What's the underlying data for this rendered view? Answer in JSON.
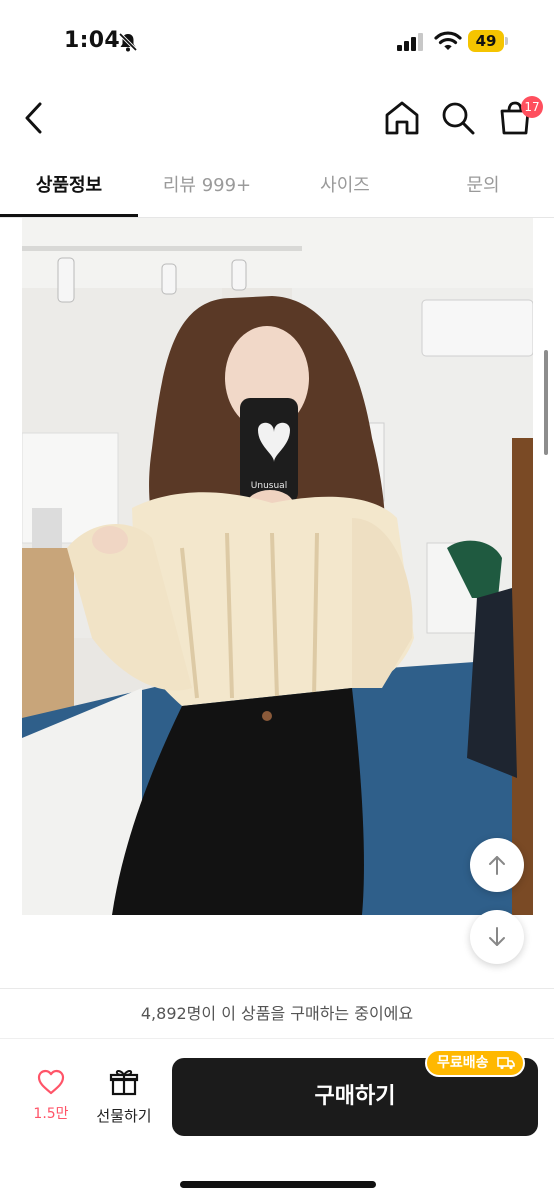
{
  "status_bar": {
    "time": "1:04",
    "battery": "49"
  },
  "nav": {
    "cart_count": "17"
  },
  "tabs": [
    {
      "label": "상품정보",
      "active": true
    },
    {
      "label": "리뷰 999+",
      "active": false
    },
    {
      "label": "사이즈",
      "active": false
    },
    {
      "label": "문의",
      "active": false
    }
  ],
  "photo": {
    "phone_case_text": "Unusual"
  },
  "bottom": {
    "viewer_text": "4,892명이 이 상품을 구매하는 중이에요",
    "like_count": "1.5만",
    "gift_label": "선물하기",
    "buy_label": "구매하기",
    "free_shipping_label": "무료배송"
  },
  "colors": {
    "accent_pink": "#ff5468",
    "badge_red": "#ff4f5e",
    "shipping_yellow": "#ffb800",
    "button_dark": "#1b1b1b"
  },
  "icons": [
    "back-icon",
    "home-icon",
    "search-icon",
    "cart-icon",
    "scroll-up-icon",
    "scroll-down-icon",
    "heart-icon",
    "gift-icon",
    "truck-icon"
  ]
}
